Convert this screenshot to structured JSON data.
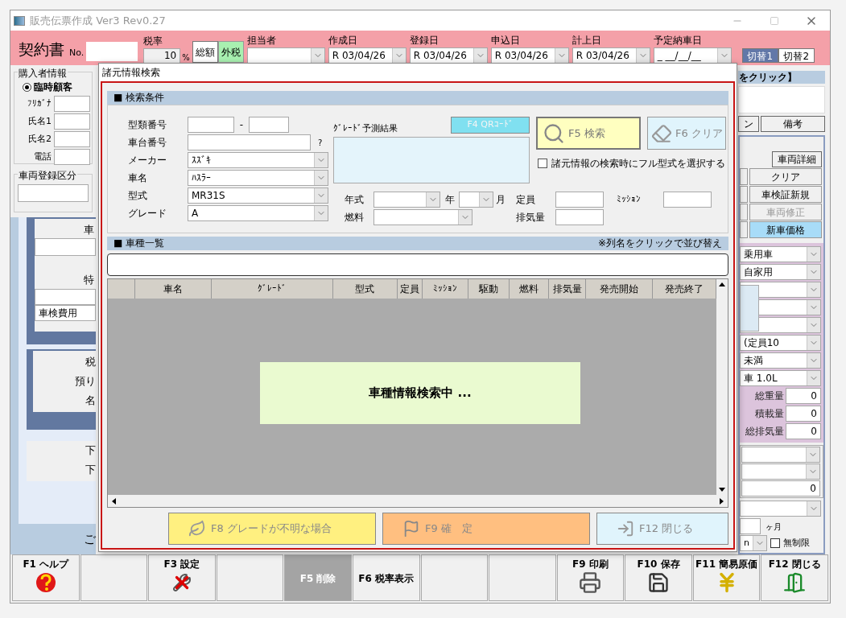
{
  "window": {
    "title": "販売伝票作成 Ver3 Rev0.27"
  },
  "header": {
    "doc_title": "契約書",
    "no_label": "No.",
    "tax_label": "税率",
    "tax_rate": "10",
    "percent": "%",
    "tax_modes": [
      {
        "label": "総額",
        "selected": false
      },
      {
        "label": "外税",
        "selected": true
      }
    ],
    "date_fields": [
      {
        "label": "担当者"
      },
      {
        "label": "作成日",
        "value": "R 03/04/26"
      },
      {
        "label": "登録日",
        "value": "R 03/04/26"
      },
      {
        "label": "申込日",
        "value": "R 03/04/26"
      },
      {
        "label": "計上日",
        "value": "R 03/04/26"
      },
      {
        "label": "予定納車日",
        "value": "_ __/__/__"
      }
    ],
    "switches": [
      {
        "label": "切替1",
        "selected": true
      },
      {
        "label": "切替2",
        "selected": false
      }
    ]
  },
  "buyer": {
    "title": "購入者情報",
    "radio": {
      "label": "臨時顧客",
      "selected": true
    },
    "fields": [
      "ﾌﾘｶﾞﾅ",
      "氏名1",
      "氏名2",
      "電話"
    ]
  },
  "registration": {
    "title": "車両登録区分"
  },
  "left_panel": {
    "labels_a": [
      "車",
      "特"
    ],
    "cost_field": "車検費用",
    "labels_b": [
      "税",
      "預り",
      "名"
    ],
    "labels_c": [
      "下",
      "下"
    ],
    "footer": "ご"
  },
  "right_panel": {
    "hint": "をクリック】",
    "tabs": [
      "ン",
      "備考"
    ],
    "buttons": [
      {
        "label": "クリア",
        "kind": "plain"
      },
      {
        "label": "車検証新規",
        "kind": "plain"
      },
      {
        "label": "車両修正",
        "kind": "disabled"
      },
      {
        "label": "新車価格",
        "kind": "accent"
      }
    ],
    "detail_button": "車両詳細",
    "selects": [
      {
        "kind": "value",
        "value": "乗用車"
      },
      {
        "kind": "value",
        "value": "自家用"
      },
      {
        "kind": "blank"
      },
      {
        "kind": "blank"
      },
      {
        "kind": "blank"
      },
      {
        "kind": "value",
        "value": "(定員10"
      },
      {
        "kind": "value",
        "value": "未満"
      },
      {
        "kind": "value",
        "value": "車 1.0L"
      }
    ],
    "weights": [
      {
        "label": "総重量",
        "value": "0"
      },
      {
        "label": "積載量",
        "value": "0"
      },
      {
        "label": "総排気量",
        "value": "0"
      }
    ],
    "amount": "0",
    "months_unit": "ヶ月",
    "period_value": "n",
    "unlimited": {
      "label": "無制限",
      "checked": false
    }
  },
  "function_keys": [
    {
      "kind": "key",
      "label": "F1 ヘルプ",
      "disabled": false
    },
    {
      "kind": "empty"
    },
    {
      "kind": "key",
      "label": "F3 設定",
      "disabled": false
    },
    {
      "kind": "empty"
    },
    {
      "kind": "key",
      "label": "F5 削除",
      "disabled": true
    },
    {
      "kind": "key",
      "label": "F6 税率表示",
      "disabled": false
    },
    {
      "kind": "empty"
    },
    {
      "kind": "empty"
    },
    {
      "kind": "key",
      "label": "F9 印刷",
      "disabled": false
    },
    {
      "kind": "key",
      "label": "F10 保存",
      "disabled": false
    },
    {
      "kind": "key",
      "label": "F11 簡易原価",
      "disabled": false
    },
    {
      "kind": "key",
      "label": "F12 閉じる",
      "disabled": false
    }
  ],
  "dialog": {
    "title": "諸元情報検索",
    "conditions_title": "■ 検索条件",
    "model_no": {
      "label": "型類番号",
      "dash": "-"
    },
    "chassis": {
      "label": "車台番号",
      "hint": "?"
    },
    "selects": [
      {
        "label": "メーカー",
        "value": "ｽｽﾞｷ"
      },
      {
        "label": "車名",
        "value": "ﾊｽﾗｰ"
      },
      {
        "label": "型式",
        "value": "MR31S"
      },
      {
        "label": "グレード",
        "value": "A"
      }
    ],
    "prediction_label": "ｸﾞﾚｰﾄﾞ予測結果",
    "qr_button": "F4 QRｺｰﾄﾞ",
    "search_button": "F5 検索",
    "clear_button": "F6 クリア",
    "full_model": {
      "label": "諸元情報の検索時にフル型式を選択する",
      "checked": false
    },
    "year_label": "年式",
    "year_unit": "年",
    "month_unit": "月",
    "capacity_label": "定員",
    "mission_label": "ﾐｯｼｮﾝ",
    "fuel_label": "燃料",
    "displacement_label": "排気量",
    "list_title": "■ 車種一覧",
    "sort_hint": "※列名をクリックで並び替え",
    "columns": [
      "車名",
      "ｸﾞﾚｰﾄﾞ",
      "型式",
      "定員",
      "ﾐｯｼｮﾝ",
      "駆動",
      "燃料",
      "排気量",
      "発売開始",
      "発売終了"
    ],
    "loading": "車種情報検索中 ...",
    "bottom_buttons": [
      {
        "label": "F8 グレードが不明な場合",
        "kind": "unknown"
      },
      {
        "label": "F9 確　定",
        "kind": "confirm"
      },
      {
        "label": "F12 閉じる",
        "kind": "close"
      }
    ]
  }
}
